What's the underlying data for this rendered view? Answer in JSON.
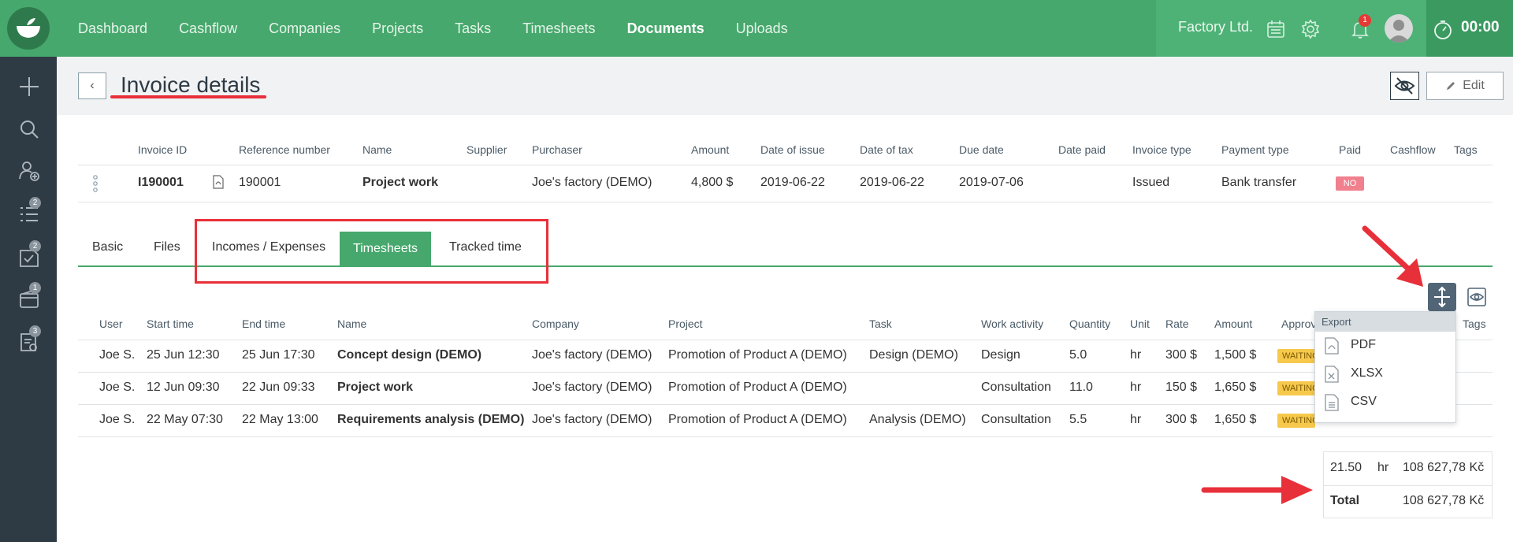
{
  "nav": {
    "items": [
      "Dashboard",
      "Cashflow",
      "Companies",
      "Projects",
      "Tasks",
      "Timesheets",
      "Documents",
      "Uploads"
    ],
    "active": "Documents",
    "company": "Factory Ltd.",
    "notification_count": "1",
    "timer": "00:00"
  },
  "sidebar": {
    "icons": [
      "plus-icon",
      "search-icon",
      "add-user-icon",
      "list-icon",
      "task-check-icon",
      "wallet-icon",
      "document-gear-icon"
    ],
    "badges": [
      "2",
      "2",
      "1",
      "3"
    ]
  },
  "header": {
    "title": "Invoice details",
    "edit_label": "Edit",
    "back_label": "‹"
  },
  "invoice": {
    "columns": [
      "Invoice ID",
      "Reference number",
      "Name",
      "Supplier",
      "Purchaser",
      "Amount",
      "Date of issue",
      "Date of tax",
      "Due date",
      "Date paid",
      "Invoice type",
      "Payment type",
      "Paid",
      "Cashflow",
      "Tags"
    ],
    "row": {
      "invoice_id": "I190001",
      "reference": "190001",
      "name": "Project work",
      "supplier": "",
      "purchaser": "Joe's factory (DEMO)",
      "amount": "4,800 $",
      "date_issue": "2019-06-22",
      "date_tax": "2019-06-22",
      "due_date": "2019-07-06",
      "date_paid": "",
      "invoice_type": "Issued",
      "payment_type": "Bank transfer",
      "paid": "NO"
    }
  },
  "tabs": {
    "basic": "Basic",
    "files": "Files",
    "incomes": "Incomes / Expenses",
    "timesheets": "Timesheets",
    "tracked": "Tracked time",
    "active": "Timesheets"
  },
  "timesheets": {
    "columns": [
      "User",
      "Start time",
      "End time",
      "Name",
      "Company",
      "Project",
      "Task",
      "Work activity",
      "Quantity",
      "Unit",
      "Rate",
      "Amount",
      "Approv",
      "Tags"
    ],
    "rows": [
      {
        "user": "Joe S.",
        "start": "25 Jun 12:30",
        "end": "25 Jun 17:30",
        "name": "Concept design (DEMO)",
        "company": "Joe's factory (DEMO)",
        "project": "Promotion of Product A (DEMO)",
        "task": "Design (DEMO)",
        "activity": "Design",
        "quantity": "5.0",
        "unit": "hr",
        "rate": "300 $",
        "amount": "1,500 $",
        "status": "WAITING"
      },
      {
        "user": "Joe S.",
        "start": "12 Jun 09:30",
        "end": "22 Jun 09:33",
        "name": "Project work",
        "company": "Joe's factory (DEMO)",
        "project": "Promotion of Product A (DEMO)",
        "task": "",
        "activity": "Consultation",
        "quantity": "11.0",
        "unit": "hr",
        "rate": "150 $",
        "amount": "1,650 $",
        "status": "WAITING"
      },
      {
        "user": "Joe S.",
        "start": "22 May 07:30",
        "end": "22 May 13:00",
        "name": "Requirements analysis (DEMO)",
        "company": "Joe's factory (DEMO)",
        "project": "Promotion of Product A (DEMO)",
        "task": "Analysis (DEMO)",
        "activity": "Consultation",
        "quantity": "5.5",
        "unit": "hr",
        "rate": "300 $",
        "amount": "1,650 $",
        "status": "WAITING"
      }
    ]
  },
  "export_menu": {
    "header": "Export",
    "items": [
      "PDF",
      "XLSX",
      "CSV"
    ]
  },
  "totals": {
    "hours": "21.50",
    "unit": "hr",
    "amount": "108 627,78 Kč",
    "total_label": "Total",
    "total_amount": "108 627,78 Kč"
  },
  "colors": {
    "brand_green": "#46a86c",
    "sidebar": "#2f3b44",
    "annotation_red": "#e8303a"
  }
}
